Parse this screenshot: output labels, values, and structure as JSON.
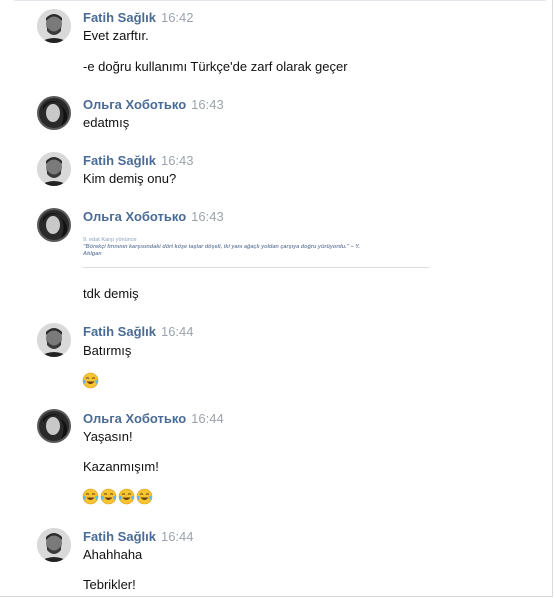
{
  "messages": [
    {
      "author": "Fatih Sağlık",
      "time": "16:42",
      "lines": [
        "Evet zarftır.",
        "-e doğru kullanımı Türkçe'de zarf olarak geçer"
      ]
    },
    {
      "author": "Ольга Хоботько",
      "time": "16:43",
      "lines": [
        "edatmış"
      ]
    },
    {
      "author": "Fatih Sağlık",
      "time": "16:43",
      "lines": [
        "Kim demiş onu?"
      ]
    },
    {
      "author": "Ольга Хоботько",
      "time": "16:43",
      "snippet": {
        "heading": "9. edat Karşı yönünce",
        "quote": "\"Börekçi fırınının karşısındaki dört köşe taşlar döşeli, iki yanı ağaçlı yoldan çarşıya doğru yürüyordu.\" – Y.",
        "author": "Atılgan"
      },
      "lines": [
        "tdk demiş"
      ]
    },
    {
      "author": "Fatih Sağlık",
      "time": "16:44",
      "lines": [
        "Batırmış"
      ],
      "emoji": [
        "tears-of-joy-emoji"
      ]
    },
    {
      "author": "Ольга Хоботько",
      "time": "16:44",
      "lines": [
        "Yaşasın!",
        "Kazanmışım!"
      ],
      "emoji": [
        "tears-of-joy-emoji",
        "tears-of-joy-emoji",
        "tears-of-joy-emoji",
        "tears-of-joy-emoji"
      ]
    },
    {
      "author": "Fatih Sağlık",
      "time": "16:44",
      "lines": [
        "Ahahhaha",
        "Tebrikler!"
      ]
    }
  ],
  "colors": {
    "author": "#4a6b95",
    "time": "#9ba3ad",
    "text": "#111111"
  }
}
